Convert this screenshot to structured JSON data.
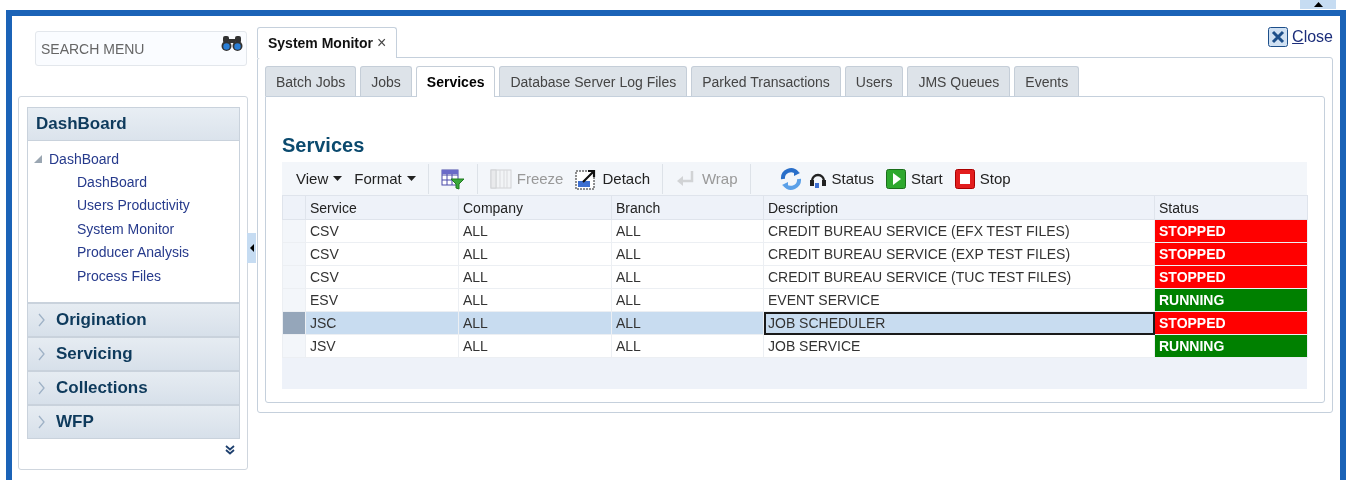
{
  "search": {
    "placeholder": "SEARCH MENU"
  },
  "sidebar": {
    "sections": [
      {
        "label": "DashBoard",
        "expanded": true,
        "tree": [
          {
            "label": "DashBoard",
            "expanded": true,
            "children": [
              {
                "label": "DashBoard"
              },
              {
                "label": "Users Productivity"
              },
              {
                "label": "System Monitor"
              },
              {
                "label": "Producer Analysis"
              },
              {
                "label": "Process Files"
              }
            ]
          }
        ]
      },
      {
        "label": "Origination",
        "expanded": false
      },
      {
        "label": "Servicing",
        "expanded": false
      },
      {
        "label": "Collections",
        "expanded": false
      },
      {
        "label": "WFP",
        "expanded": false
      }
    ]
  },
  "document_tabs": [
    {
      "label": "System Monitor",
      "close": "×",
      "selected": true
    }
  ],
  "close_link": "Close",
  "tabs": [
    {
      "label": "Batch Jobs",
      "selected": false
    },
    {
      "label": "Jobs",
      "selected": false
    },
    {
      "label": "Services",
      "selected": true
    },
    {
      "label": "Database Server Log Files",
      "selected": false
    },
    {
      "label": "Parked Transactions",
      "selected": false
    },
    {
      "label": "Users",
      "selected": false
    },
    {
      "label": "JMS Queues",
      "selected": false
    },
    {
      "label": "Events",
      "selected": false
    }
  ],
  "panel": {
    "title": "Services",
    "toolbar": [
      {
        "kind": "menu",
        "label": "View"
      },
      {
        "kind": "menu",
        "label": "Format"
      },
      {
        "kind": "separator"
      },
      {
        "kind": "icon",
        "disabled": false
      },
      {
        "kind": "separator"
      },
      {
        "kind": "button",
        "label": "Freeze",
        "disabled": true
      },
      {
        "kind": "button",
        "label": "Detach",
        "disabled": false
      },
      {
        "kind": "separator"
      },
      {
        "kind": "button",
        "label": "Wrap",
        "disabled": true
      },
      {
        "kind": "separator"
      },
      {
        "kind": "icon",
        "disabled": false
      },
      {
        "kind": "button",
        "label": "Status",
        "disabled": false
      },
      {
        "kind": "button",
        "label": "Start",
        "disabled": false
      },
      {
        "kind": "button",
        "label": "Stop",
        "disabled": false
      }
    ],
    "table": {
      "columns": [
        "Service",
        "Company",
        "Branch",
        "Description",
        "Status"
      ],
      "rows": [
        {
          "cells": [
            "CSV",
            "ALL",
            "ALL",
            "CREDIT BUREAU SERVICE (EFX TEST FILES)"
          ],
          "status": {
            "text": "STOPPED",
            "color": "#ff0000"
          },
          "selected": false
        },
        {
          "cells": [
            "CSV",
            "ALL",
            "ALL",
            "CREDIT BUREAU SERVICE (EXP TEST FILES)"
          ],
          "status": {
            "text": "STOPPED",
            "color": "#ff0000"
          },
          "selected": false
        },
        {
          "cells": [
            "CSV",
            "ALL",
            "ALL",
            "CREDIT BUREAU SERVICE (TUC TEST FILES)"
          ],
          "status": {
            "text": "STOPPED",
            "color": "#ff0000"
          },
          "selected": false
        },
        {
          "cells": [
            "ESV",
            "ALL",
            "ALL",
            "EVENT SERVICE"
          ],
          "status": {
            "text": "RUNNING",
            "color": "#008000"
          },
          "selected": false
        },
        {
          "cells": [
            "JSC",
            "ALL",
            "ALL",
            "JOB SCHEDULER"
          ],
          "status": {
            "text": "STOPPED",
            "color": "#ff0000"
          },
          "selected": true
        },
        {
          "cells": [
            "JSV",
            "ALL",
            "ALL",
            "JOB SERVICE"
          ],
          "status": {
            "text": "RUNNING",
            "color": "#008000"
          },
          "selected": false
        }
      ]
    }
  }
}
